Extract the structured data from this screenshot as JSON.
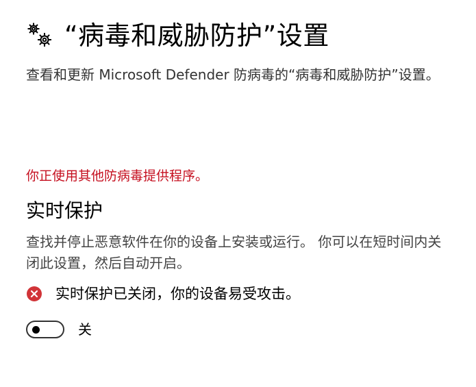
{
  "header": {
    "icon": "gears-icon",
    "title": "“病毒和威胁防护”设置"
  },
  "description": "查看和更新 Microsoft Defender 防病毒的“病毒和威胁防护”设置。",
  "warning": {
    "text": "你正使用其他防病毒提供程序。",
    "color": "#c50f1f"
  },
  "realtime": {
    "title": "实时保护",
    "description": "查找并停止恶意软件在你的设备上安装或运行。 你可以在短时间内关闭此设置，然后自动开启。",
    "status": {
      "icon": "error-x-circle-icon",
      "icon_color": "#d13438",
      "text": "实时保护已关闭，你的设备易受攻击。"
    },
    "toggle": {
      "state": "off",
      "label": "关"
    }
  }
}
